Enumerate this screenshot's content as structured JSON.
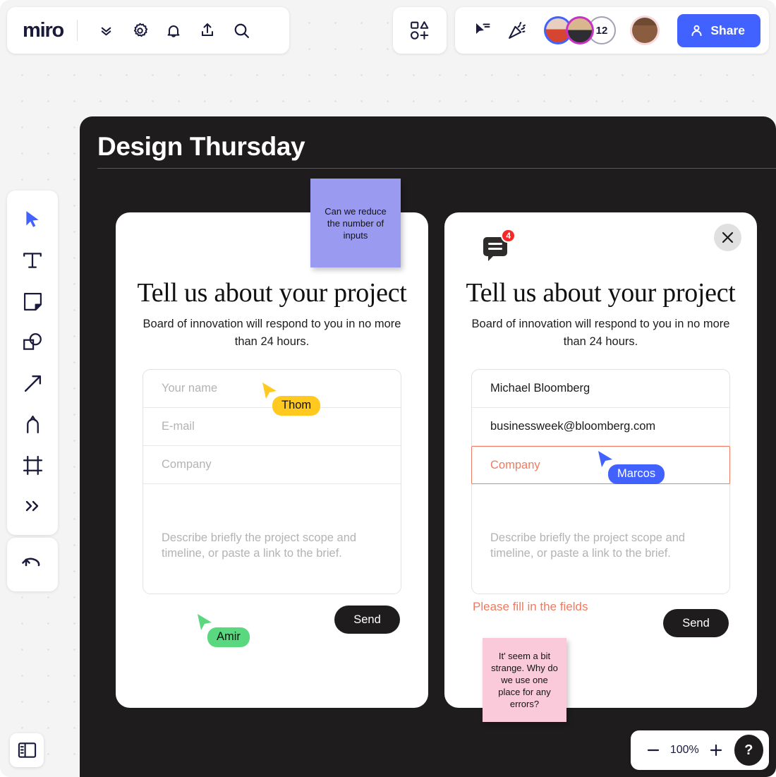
{
  "topbar": {
    "logo": "miro",
    "icons": [
      {
        "name": "chevrons-down-icon",
        "label": "Board menu"
      },
      {
        "name": "gear-icon",
        "label": "Settings"
      },
      {
        "name": "bell-icon",
        "label": "Notifications"
      },
      {
        "name": "upload-icon",
        "label": "Upload"
      },
      {
        "name": "search-icon",
        "label": "Search"
      }
    ],
    "shapes_button": {
      "name": "shapes-add-icon",
      "label": "Add shapes"
    },
    "cursor_button": {
      "name": "cursor-chat-icon",
      "label": "Cursor chat"
    },
    "celebrate_button": {
      "name": "party-popper-icon",
      "label": "Celebrate"
    },
    "collaborators": [
      {
        "name": "avatar-collaborator-1",
        "ring": "#4262ff"
      },
      {
        "name": "avatar-collaborator-2",
        "ring": "#c634bf"
      }
    ],
    "collaborator_count": "12",
    "current_user": {
      "name": "avatar-current-user"
    },
    "share_label": "Share",
    "share_color": "#4262ff"
  },
  "toolrail": {
    "tools": [
      {
        "name": "select-tool",
        "label": "Select",
        "active": true
      },
      {
        "name": "text-tool",
        "label": "Text"
      },
      {
        "name": "sticky-note-tool",
        "label": "Sticky note"
      },
      {
        "name": "shapes-tool",
        "label": "Shapes"
      },
      {
        "name": "arrow-tool",
        "label": "Connection line"
      },
      {
        "name": "pen-tool",
        "label": "Pen"
      },
      {
        "name": "frame-tool",
        "label": "Frame"
      },
      {
        "name": "more-tools",
        "label": "More tools"
      }
    ],
    "undo": {
      "name": "undo-icon",
      "label": "Undo"
    },
    "panel_toggle": {
      "name": "panel-toggle-icon",
      "label": "Toggle panel"
    }
  },
  "frame": {
    "title": "Design Thursday"
  },
  "form_left": {
    "title": "Tell us about your project",
    "subtitle": "Board of innovation will respond to you in no more than 24 hours.",
    "fields": [
      {
        "name": "name-field",
        "placeholder": "Your name",
        "value": ""
      },
      {
        "name": "email-field",
        "placeholder": "E-mail",
        "value": ""
      },
      {
        "name": "company-field",
        "placeholder": "Company",
        "value": ""
      },
      {
        "name": "description-field",
        "placeholder": "Describe briefly the project scope and timeline, or paste a link to the brief.",
        "value": ""
      }
    ],
    "send_label": "Send"
  },
  "form_right": {
    "title": "Tell us about your project",
    "subtitle": "Board of innovation will respond to you in no more than 24 hours.",
    "comment_count": "4",
    "fields": [
      {
        "name": "name-field",
        "placeholder": "Your name",
        "value": "Michael Bloomberg"
      },
      {
        "name": "email-field",
        "placeholder": "E-mail",
        "value": "businessweek@bloomberg.com"
      },
      {
        "name": "company-field",
        "placeholder": "Company",
        "value": "",
        "error": true
      },
      {
        "name": "description-field",
        "placeholder": "Describe briefly the project scope and timeline, or paste a link to the brief.",
        "value": ""
      }
    ],
    "error_message": "Please fill in the fields",
    "error_color": "#ef7a5f",
    "send_label": "Send"
  },
  "stickies": [
    {
      "name": "sticky-note-purple",
      "text": "Can we reduce the number of inputs",
      "color": "#9a9af0"
    },
    {
      "name": "sticky-note-pink",
      "text": "It' seem a bit strange. Why do we use one place for any errors?",
      "color": "#fbcada"
    }
  ],
  "cursors": [
    {
      "name": "cursor-thom",
      "label": "Thom",
      "color": "#ffc91f",
      "text_color": "#111111"
    },
    {
      "name": "cursor-amir",
      "label": "Amir",
      "color": "#59d87f",
      "text_color": "#111111"
    },
    {
      "name": "cursor-marcos",
      "label": "Marcos",
      "color": "#4262ff",
      "text_color": "#ffffff"
    }
  ],
  "zoombar": {
    "zoom_out": "−",
    "level": "100%",
    "zoom_in": "+",
    "help": "?"
  }
}
